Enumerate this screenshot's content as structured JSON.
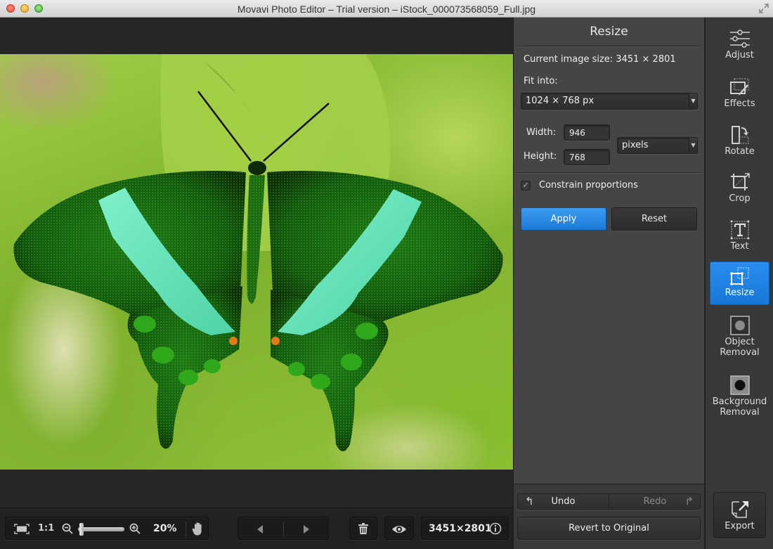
{
  "window": {
    "title": "Movavi Photo Editor – Trial version – iStock_000073568059_Full.jpg",
    "controls": [
      "close",
      "minimize",
      "maximize"
    ],
    "fullscreen_icon": "fullscreen-arrows-icon"
  },
  "canvas": {
    "image_description": "Emerald swallowtail butterfly with green wings and turquoise bands on a green leaf background"
  },
  "bottom_toolbar": {
    "fit_icon": "fit-to-screen-icon",
    "one_to_one_label": "1:1",
    "zoom_out_icon": "zoom-out-icon",
    "zoom_slider_fraction": 0.0,
    "zoom_in_icon": "zoom-in-icon",
    "zoom_percent": "20%",
    "hand_icon": "hand-pan-icon",
    "prev_icon": "prev-arrow-icon",
    "next_icon": "next-arrow-icon",
    "delete_icon": "trash-icon",
    "preview_icon": "eye-icon",
    "image_dimensions": "3451×2801",
    "info_icon": "info-icon"
  },
  "panel": {
    "title": "Resize",
    "current_size_label": "Current image size: 3451 × 2801",
    "fit_into_label": "Fit into:",
    "fit_into_value": "1024 × 768 px",
    "width_label": "Width:",
    "width_value": "946",
    "height_label": "Height:",
    "height_value": "768",
    "unit_value": "pixels",
    "constrain_label": "Constrain proportions",
    "constrain_checked": true,
    "apply_label": "Apply",
    "reset_label": "Reset",
    "undo_label": "Undo",
    "redo_label": "Redo",
    "revert_label": "Revert to Original"
  },
  "tools": {
    "items": [
      {
        "label": "Adjust",
        "icon": "sliders-icon",
        "active": false
      },
      {
        "label": "Effects",
        "icon": "effects-brush-icon",
        "active": false
      },
      {
        "label": "Rotate",
        "icon": "rotate-icon",
        "active": false
      },
      {
        "label": "Crop",
        "icon": "crop-icon",
        "active": false
      },
      {
        "label": "Text",
        "icon": "text-icon",
        "active": false
      },
      {
        "label": "Resize",
        "icon": "resize-icon",
        "active": true
      },
      {
        "label": "Object Removal",
        "label_line1": "Object",
        "label_line2": "Removal",
        "icon": "object-removal-icon",
        "active": false
      },
      {
        "label": "Background Removal",
        "label_line1": "Background",
        "label_line2": "Removal",
        "icon": "background-removal-icon",
        "active": false
      }
    ],
    "export_label": "Export",
    "export_icon": "export-icon"
  },
  "colors": {
    "accent": "#1f84e4",
    "panel_bg": "#454545",
    "sidebar_bg": "#383838",
    "canvas_bg": "#262626"
  }
}
